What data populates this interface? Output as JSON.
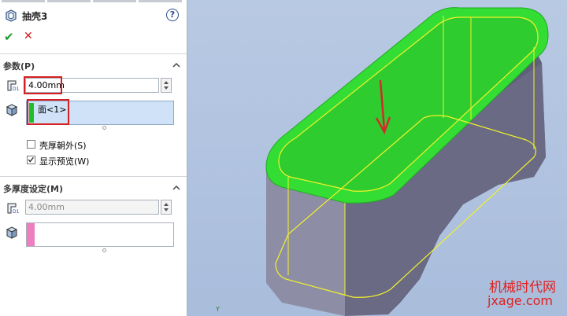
{
  "panel": {
    "title": "抽壳3",
    "help_label": "?",
    "ok_label": "✔",
    "cancel_label": "✕",
    "params": {
      "title": "参数(P)",
      "thickness_value": "4.00mm",
      "faces_item": "面<1>",
      "outward_label": "壳厚朝外(S)",
      "outward_checked": false,
      "preview_label": "显示预览(W)",
      "preview_checked": true
    },
    "multi": {
      "title": "多厚度设定(M)",
      "thickness_value": "4.00mm"
    }
  },
  "colors": {
    "face_green": "#33dd33",
    "model_gray": "#6f6f88",
    "edge_yellow": "#f2f22a",
    "arrow_red": "#d42a2a",
    "highlight_red": "#d62020",
    "selection_blue": "#cfe2f7"
  },
  "watermark": {
    "line1": "机械时代网",
    "line2": "jxage.com"
  },
  "triad_label": "Y"
}
